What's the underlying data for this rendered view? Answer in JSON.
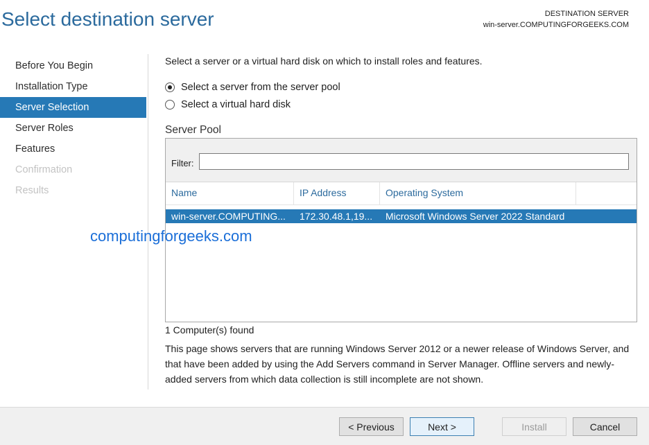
{
  "header": {
    "title": "Select destination server",
    "destination_label": "DESTINATION SERVER",
    "destination_value": "win-server.COMPUTINGFORGEEKS.COM"
  },
  "nav": {
    "items": [
      {
        "label": "Before You Begin",
        "state": "normal"
      },
      {
        "label": "Installation Type",
        "state": "normal"
      },
      {
        "label": "Server Selection",
        "state": "selected"
      },
      {
        "label": "Server Roles",
        "state": "normal"
      },
      {
        "label": "Features",
        "state": "normal"
      },
      {
        "label": "Confirmation",
        "state": "disabled"
      },
      {
        "label": "Results",
        "state": "disabled"
      }
    ]
  },
  "main": {
    "intro": "Select a server or a virtual hard disk on which to install roles and features.",
    "radio_pool": "Select a server from the server pool",
    "radio_vhd": "Select a virtual hard disk",
    "pool_label": "Server Pool",
    "filter_label": "Filter:",
    "filter_value": "",
    "columns": [
      "Name",
      "IP Address",
      "Operating System",
      ""
    ],
    "rows": [
      {
        "name": "win-server.COMPUTING...",
        "ip": "172.30.48.1,19...",
        "os": "Microsoft Windows Server 2022 Standard"
      }
    ],
    "found": "1 Computer(s) found",
    "description": "This page shows servers that are running Windows Server 2012 or a newer release of Windows Server, and that have been added by using the Add Servers command in Server Manager. Offline servers and newly-added servers from which data collection is still incomplete are not shown."
  },
  "watermark": "computingforgeeks.com",
  "footer": {
    "previous": "< Previous",
    "next": "Next >",
    "install": "Install",
    "cancel": "Cancel"
  },
  "colors": {
    "accent": "#2679b6",
    "title": "#2b6a9d",
    "watermark": "#1a6ed8"
  }
}
